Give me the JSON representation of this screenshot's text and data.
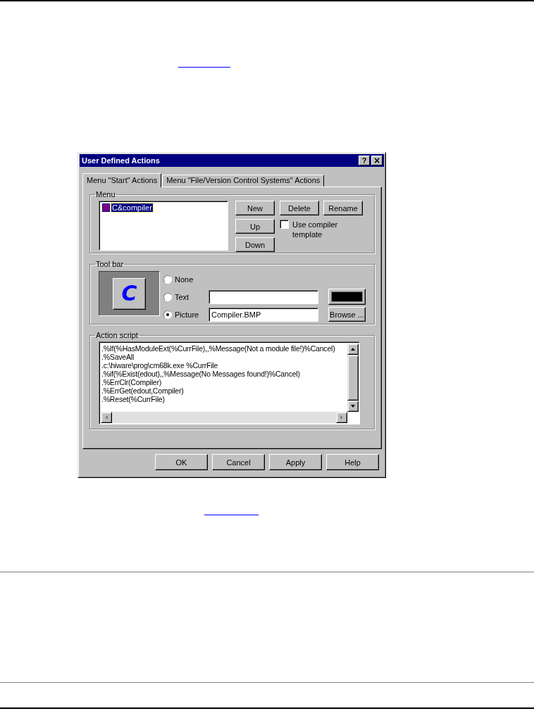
{
  "dialog": {
    "title": "User Defined Actions",
    "title_buttons": [
      {
        "kind": "help",
        "label": "?"
      },
      {
        "kind": "close",
        "label": "×"
      }
    ],
    "tabs": [
      {
        "label": "Menu \"Start\" Actions",
        "selected": true
      },
      {
        "label": "Menu \"File/Version Control Systems\" Actions",
        "selected": false
      }
    ],
    "menu_group": {
      "label": "Menu",
      "items": [
        {
          "label": "C&compiler",
          "selected": true
        }
      ],
      "buttons": [
        "New",
        "Delete",
        "Rename",
        "Up",
        "Down"
      ],
      "use_template": {
        "label": "Use compiler template",
        "checked": false
      }
    },
    "toolbar_group": {
      "label": "Tool bar",
      "preview_glyph": "C",
      "options": [
        {
          "label": "None",
          "selected": false
        },
        {
          "label": "Text",
          "selected": false
        },
        {
          "label": "Picture",
          "selected": true
        }
      ],
      "picture_value": "Compiler.BMP",
      "color": "#000000",
      "browse_button": "Browse ..."
    },
    "script_group": {
      "label": "Action script",
      "lines": [
        ".%If(%HasModuleExt(%CurrFile),,%Message(Not a module file!)%Cancel)",
        ".%SaveAll",
        ".c:\\hiware\\prog\\cm68k.exe %CurrFile",
        ".%if(%Exist(edout),,%Message(No Messages found!)%Cancel)",
        ".%ErrClr(Compiler)",
        ".%ErrGet(edout,Compiler)",
        ".%Reset(%CurrFile)"
      ]
    },
    "buttons": [
      "OK",
      "Cancel",
      "Apply",
      "Help"
    ]
  }
}
